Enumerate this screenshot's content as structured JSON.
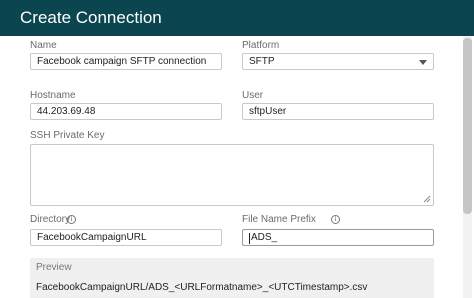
{
  "dialog": {
    "title": "Create Connection"
  },
  "form": {
    "name": {
      "label": "Name",
      "value": "Facebook campaign SFTP connection"
    },
    "platform": {
      "label": "Platform",
      "value": "SFTP"
    },
    "hostname": {
      "label": "Hostname",
      "value": "44.203.69.48"
    },
    "user": {
      "label": "User",
      "value": "sftpUser"
    },
    "ssh_key": {
      "label": "SSH Private Key",
      "value": ""
    },
    "directory": {
      "label": "Directory",
      "value": "FacebookCampaignURL"
    },
    "file_prefix": {
      "label": "File Name Prefix",
      "value": "ADS_"
    }
  },
  "preview": {
    "label": "Preview",
    "value": "FacebookCampaignURL/ADS_<URLFormatname>_<UTCTimestamp>.csv"
  },
  "icons": {
    "info": "info-icon",
    "dropdown": "chevron-down-icon",
    "resize": "resize-handle-icon"
  },
  "colors": {
    "header_bg": "#0b4550",
    "preview_bg": "#f0f0f0"
  }
}
